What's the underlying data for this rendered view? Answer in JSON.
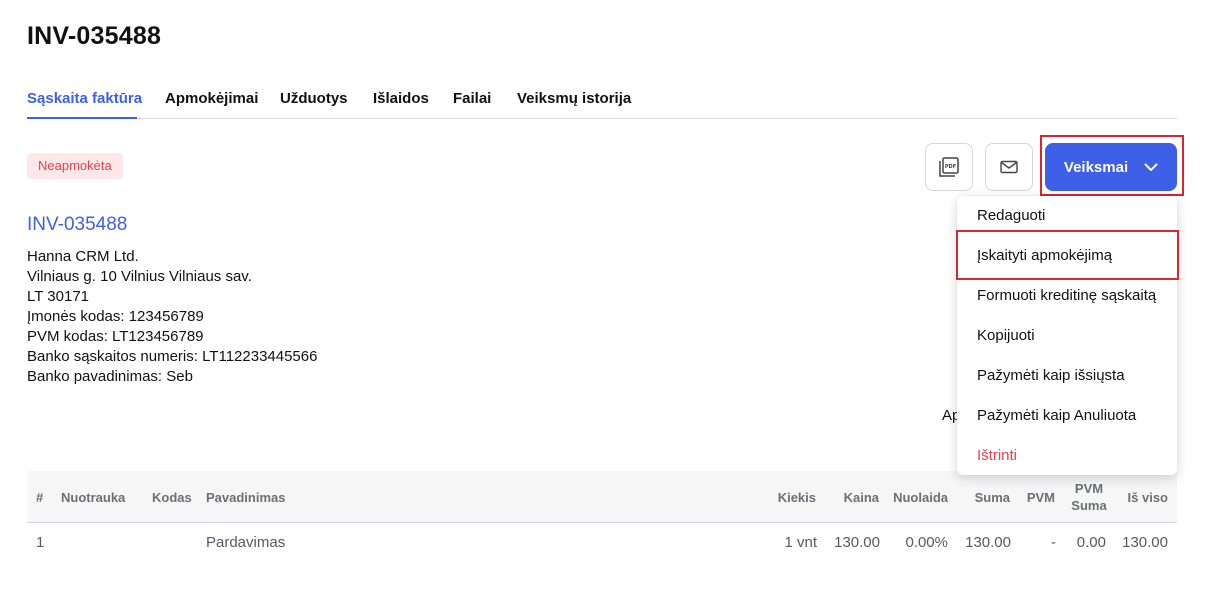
{
  "page": {
    "title": "INV-035488"
  },
  "tabs": [
    {
      "label": "Sąskaita faktūra",
      "active": true
    },
    {
      "label": "Apmokėjimai"
    },
    {
      "label": "Užduotys"
    },
    {
      "label": "Išlaidos"
    },
    {
      "label": "Failai"
    },
    {
      "label": "Veiksmų istorija"
    }
  ],
  "status": {
    "label": "Neapmokėta"
  },
  "toolbar": {
    "pdf_icon": "pdf-icon",
    "email_icon": "email-icon",
    "actions_label": "Veiksmai",
    "actions_icon": "chevron-down-icon"
  },
  "invoice": {
    "number": "INV-035488",
    "company_lines": [
      "Hanna CRM Ltd.",
      "Vilniaus g. 10 Vilnius Vilniaus sav.",
      "LT 30171",
      "Įmonės kodas: 123456789",
      "PVM kodas: LT123456789",
      "Banko sąskaitos numeris: LT112233445566",
      "Banko pavadinimas: Seb"
    ],
    "partial_label": "Ap"
  },
  "actions_menu": {
    "items": [
      {
        "label": "Redaguoti"
      },
      {
        "label": "Įskaityti apmokėjimą"
      },
      {
        "label": "Formuoti kreditinę sąskaitą"
      },
      {
        "label": "Kopijuoti"
      },
      {
        "label": "Pažymėti kaip išsiųsta"
      },
      {
        "label": "Pažymėti kaip Anuliuota"
      },
      {
        "label": "Ištrinti"
      }
    ]
  },
  "table": {
    "columns": {
      "num": "#",
      "image": "Nuotrauka",
      "code": "Kodas",
      "name": "Pavadinimas",
      "qty": "Kiekis",
      "price": "Kaina",
      "discount": "Nuolaida",
      "sum": "Suma",
      "vat": "PVM",
      "vat_sum_1": "PVM",
      "vat_sum_2": "Suma",
      "total": "Iš viso"
    },
    "rows": [
      {
        "num": "1",
        "image": "",
        "code": "",
        "name": "Pardavimas",
        "qty": "1 vnt",
        "price": "130.00",
        "discount": "0.00%",
        "sum": "130.00",
        "vat": "-",
        "vat_sum": "0.00",
        "total": "130.00"
      }
    ]
  },
  "colors": {
    "accent": "#3e5fe8",
    "danger": "#e0454d",
    "badge_bg": "#fde7e8",
    "highlight": "#d7262d"
  }
}
